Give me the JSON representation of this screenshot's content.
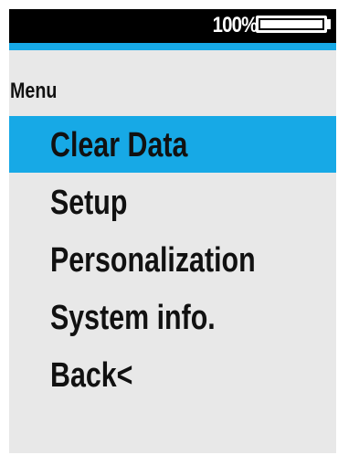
{
  "status_bar": {
    "battery_text": "100%",
    "battery_level": 1.0
  },
  "menu": {
    "heading": "Menu",
    "items": [
      {
        "label": "Clear Data",
        "selected": true
      },
      {
        "label": "Setup",
        "selected": false
      },
      {
        "label": "Personalization",
        "selected": false
      },
      {
        "label": "System info.",
        "selected": false
      },
      {
        "label": "Back<",
        "selected": false
      }
    ]
  },
  "colors": {
    "accent": "#17a9e6",
    "background": "#e8e8e8",
    "status_bar": "#000000",
    "text": "#111111"
  }
}
